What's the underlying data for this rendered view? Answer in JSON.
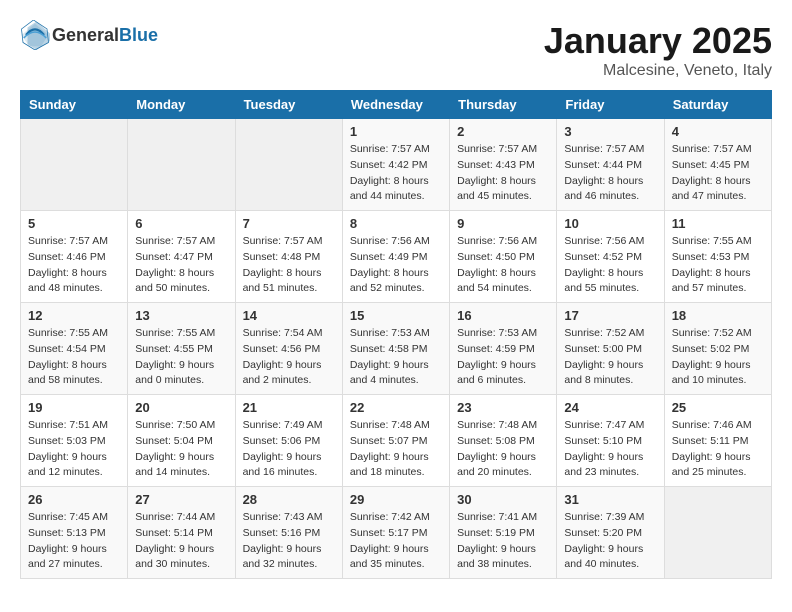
{
  "header": {
    "logo_general": "General",
    "logo_blue": "Blue",
    "month_year": "January 2025",
    "location": "Malcesine, Veneto, Italy"
  },
  "weekdays": [
    "Sunday",
    "Monday",
    "Tuesday",
    "Wednesday",
    "Thursday",
    "Friday",
    "Saturday"
  ],
  "weeks": [
    [
      {
        "day": "",
        "info": ""
      },
      {
        "day": "",
        "info": ""
      },
      {
        "day": "",
        "info": ""
      },
      {
        "day": "1",
        "info": "Sunrise: 7:57 AM\nSunset: 4:42 PM\nDaylight: 8 hours\nand 44 minutes."
      },
      {
        "day": "2",
        "info": "Sunrise: 7:57 AM\nSunset: 4:43 PM\nDaylight: 8 hours\nand 45 minutes."
      },
      {
        "day": "3",
        "info": "Sunrise: 7:57 AM\nSunset: 4:44 PM\nDaylight: 8 hours\nand 46 minutes."
      },
      {
        "day": "4",
        "info": "Sunrise: 7:57 AM\nSunset: 4:45 PM\nDaylight: 8 hours\nand 47 minutes."
      }
    ],
    [
      {
        "day": "5",
        "info": "Sunrise: 7:57 AM\nSunset: 4:46 PM\nDaylight: 8 hours\nand 48 minutes."
      },
      {
        "day": "6",
        "info": "Sunrise: 7:57 AM\nSunset: 4:47 PM\nDaylight: 8 hours\nand 50 minutes."
      },
      {
        "day": "7",
        "info": "Sunrise: 7:57 AM\nSunset: 4:48 PM\nDaylight: 8 hours\nand 51 minutes."
      },
      {
        "day": "8",
        "info": "Sunrise: 7:56 AM\nSunset: 4:49 PM\nDaylight: 8 hours\nand 52 minutes."
      },
      {
        "day": "9",
        "info": "Sunrise: 7:56 AM\nSunset: 4:50 PM\nDaylight: 8 hours\nand 54 minutes."
      },
      {
        "day": "10",
        "info": "Sunrise: 7:56 AM\nSunset: 4:52 PM\nDaylight: 8 hours\nand 55 minutes."
      },
      {
        "day": "11",
        "info": "Sunrise: 7:55 AM\nSunset: 4:53 PM\nDaylight: 8 hours\nand 57 minutes."
      }
    ],
    [
      {
        "day": "12",
        "info": "Sunrise: 7:55 AM\nSunset: 4:54 PM\nDaylight: 8 hours\nand 58 minutes."
      },
      {
        "day": "13",
        "info": "Sunrise: 7:55 AM\nSunset: 4:55 PM\nDaylight: 9 hours\nand 0 minutes."
      },
      {
        "day": "14",
        "info": "Sunrise: 7:54 AM\nSunset: 4:56 PM\nDaylight: 9 hours\nand 2 minutes."
      },
      {
        "day": "15",
        "info": "Sunrise: 7:53 AM\nSunset: 4:58 PM\nDaylight: 9 hours\nand 4 minutes."
      },
      {
        "day": "16",
        "info": "Sunrise: 7:53 AM\nSunset: 4:59 PM\nDaylight: 9 hours\nand 6 minutes."
      },
      {
        "day": "17",
        "info": "Sunrise: 7:52 AM\nSunset: 5:00 PM\nDaylight: 9 hours\nand 8 minutes."
      },
      {
        "day": "18",
        "info": "Sunrise: 7:52 AM\nSunset: 5:02 PM\nDaylight: 9 hours\nand 10 minutes."
      }
    ],
    [
      {
        "day": "19",
        "info": "Sunrise: 7:51 AM\nSunset: 5:03 PM\nDaylight: 9 hours\nand 12 minutes."
      },
      {
        "day": "20",
        "info": "Sunrise: 7:50 AM\nSunset: 5:04 PM\nDaylight: 9 hours\nand 14 minutes."
      },
      {
        "day": "21",
        "info": "Sunrise: 7:49 AM\nSunset: 5:06 PM\nDaylight: 9 hours\nand 16 minutes."
      },
      {
        "day": "22",
        "info": "Sunrise: 7:48 AM\nSunset: 5:07 PM\nDaylight: 9 hours\nand 18 minutes."
      },
      {
        "day": "23",
        "info": "Sunrise: 7:48 AM\nSunset: 5:08 PM\nDaylight: 9 hours\nand 20 minutes."
      },
      {
        "day": "24",
        "info": "Sunrise: 7:47 AM\nSunset: 5:10 PM\nDaylight: 9 hours\nand 23 minutes."
      },
      {
        "day": "25",
        "info": "Sunrise: 7:46 AM\nSunset: 5:11 PM\nDaylight: 9 hours\nand 25 minutes."
      }
    ],
    [
      {
        "day": "26",
        "info": "Sunrise: 7:45 AM\nSunset: 5:13 PM\nDaylight: 9 hours\nand 27 minutes."
      },
      {
        "day": "27",
        "info": "Sunrise: 7:44 AM\nSunset: 5:14 PM\nDaylight: 9 hours\nand 30 minutes."
      },
      {
        "day": "28",
        "info": "Sunrise: 7:43 AM\nSunset: 5:16 PM\nDaylight: 9 hours\nand 32 minutes."
      },
      {
        "day": "29",
        "info": "Sunrise: 7:42 AM\nSunset: 5:17 PM\nDaylight: 9 hours\nand 35 minutes."
      },
      {
        "day": "30",
        "info": "Sunrise: 7:41 AM\nSunset: 5:19 PM\nDaylight: 9 hours\nand 38 minutes."
      },
      {
        "day": "31",
        "info": "Sunrise: 7:39 AM\nSunset: 5:20 PM\nDaylight: 9 hours\nand 40 minutes."
      },
      {
        "day": "",
        "info": ""
      }
    ]
  ]
}
